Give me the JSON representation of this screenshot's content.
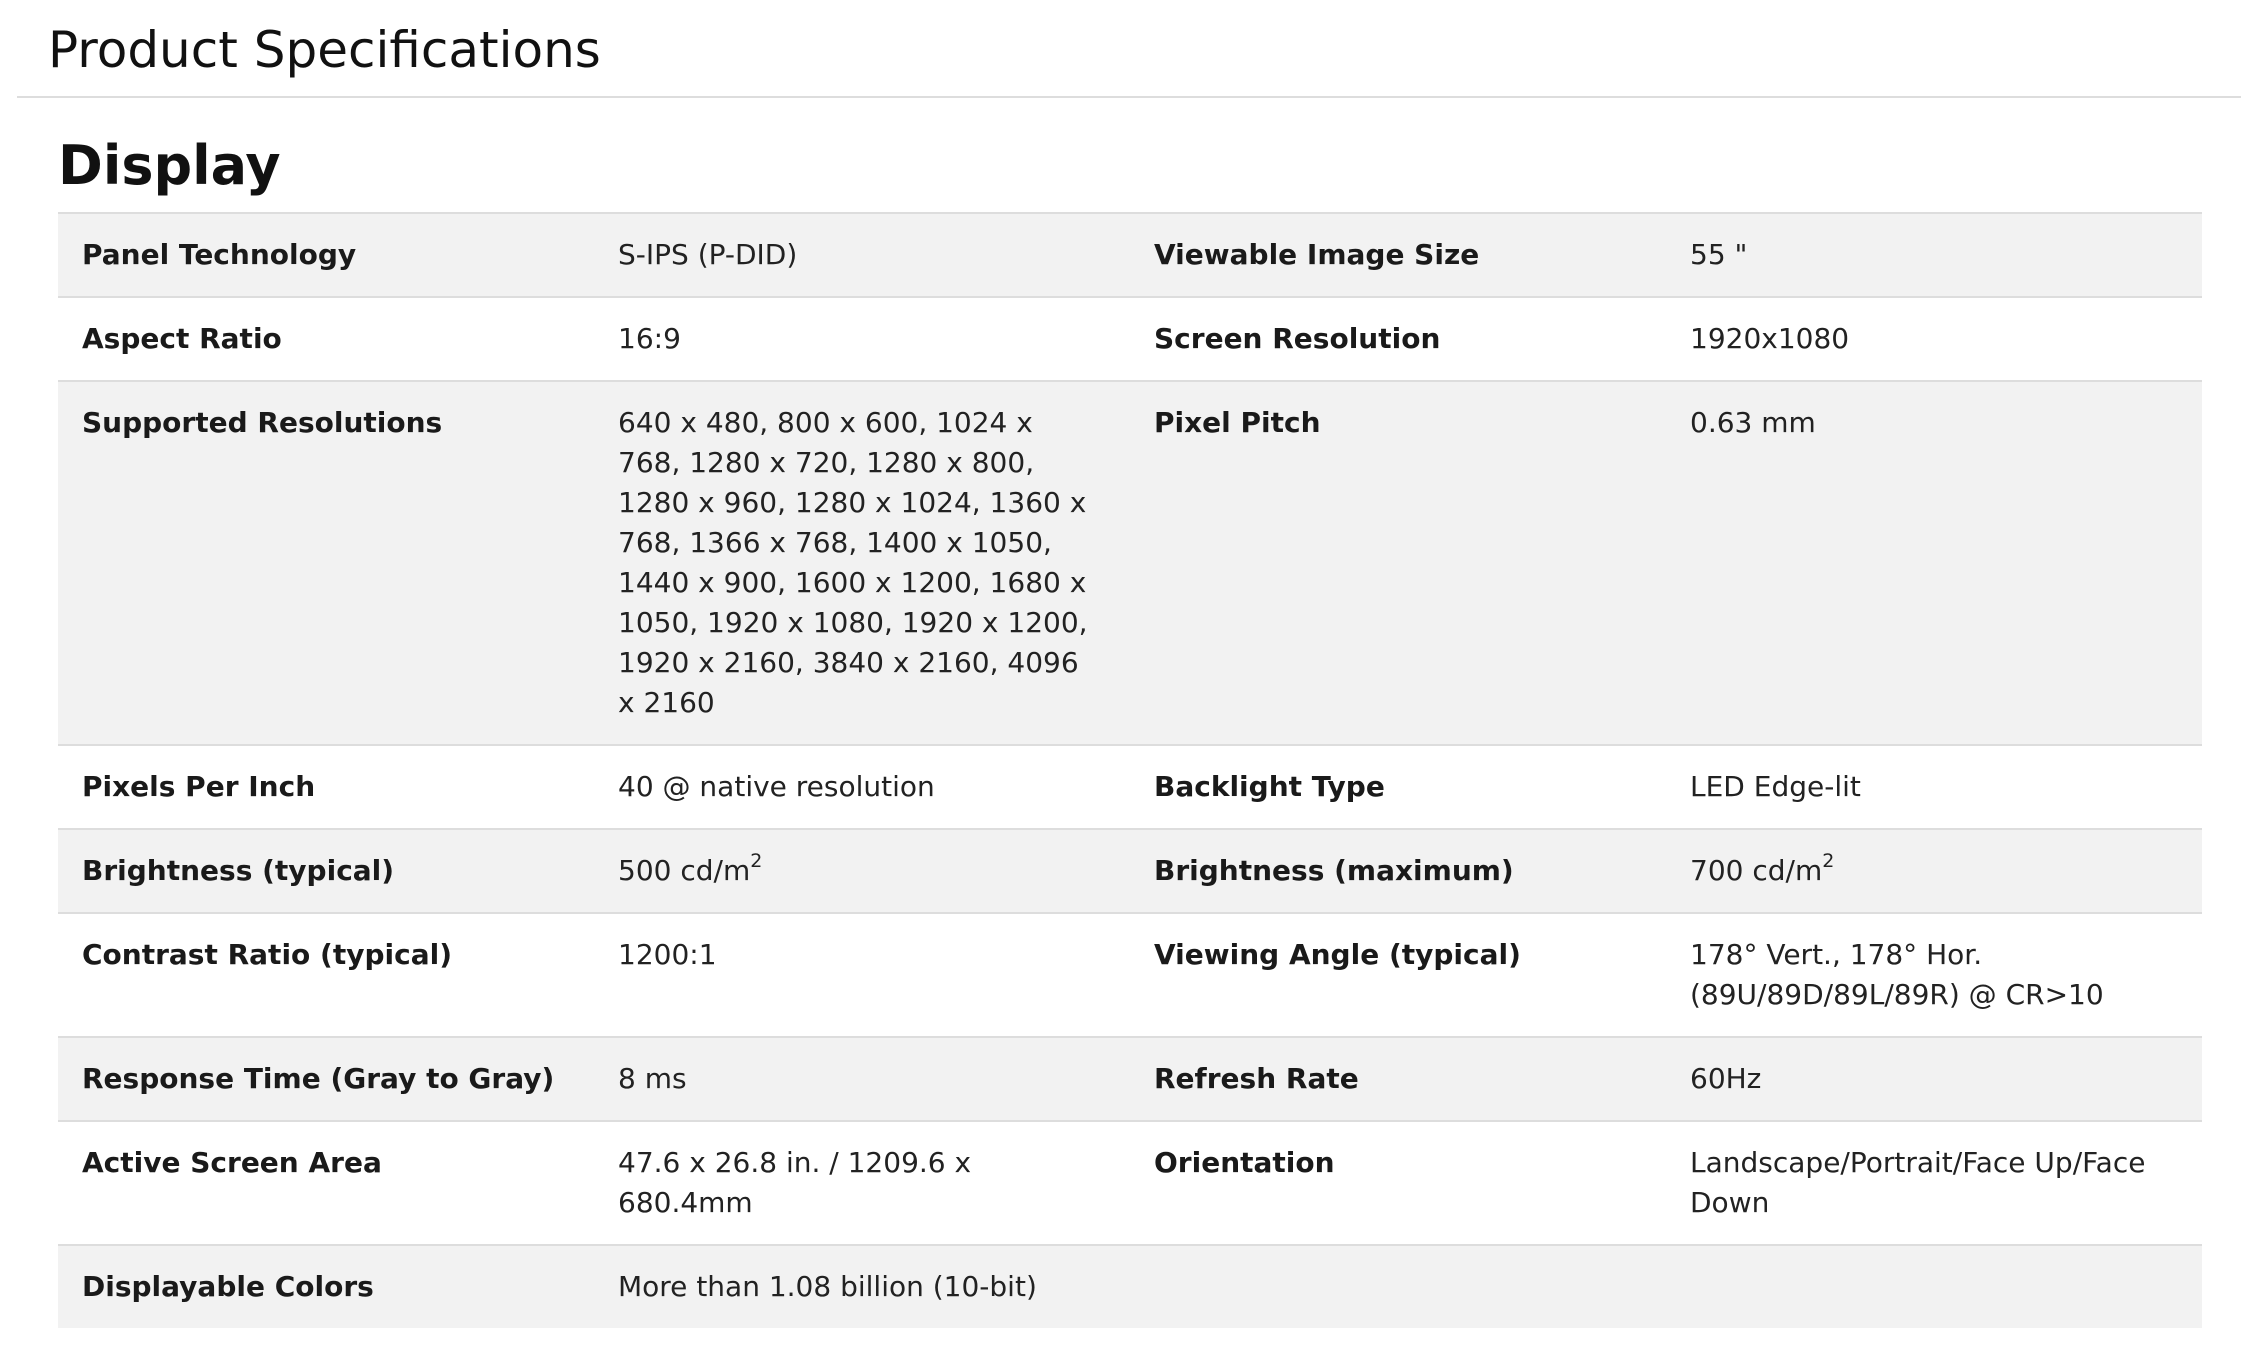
{
  "page": {
    "title": "Product Specifications"
  },
  "section": {
    "title": "Display"
  },
  "rows": [
    {
      "label1": "Panel Technology",
      "value1": "S-IPS (P-DID)",
      "label2": "Viewable Image Size",
      "value2": "55 \""
    },
    {
      "label1": "Aspect Ratio",
      "value1": "16:9",
      "label2": "Screen Resolution",
      "value2": "1920x1080"
    },
    {
      "label1": "Supported Resolutions",
      "value1": "640 x 480, 800 x 600, 1024 x 768, 1280 x 720, 1280 x 800, 1280 x 960, 1280 x 1024, 1360 x 768, 1366 x 768, 1400 x 1050, 1440 x 900, 1600 x 1200, 1680 x 1050, 1920 x 1080, 1920 x 1200, 1920 x 2160, 3840 x 2160, 4096 x 2160",
      "label2": "Pixel Pitch",
      "value2": "0.63 mm"
    },
    {
      "label1": "Pixels Per Inch",
      "value1": "40 @ native resolution",
      "label2": "Backlight Type",
      "value2": "LED Edge-lit"
    },
    {
      "label1": "Brightness (typical)",
      "value1": "500 cd/m",
      "value1_sup": "2",
      "label2": "Brightness (maximum)",
      "value2": "700 cd/m",
      "value2_sup": "2"
    },
    {
      "label1": "Contrast Ratio (typical)",
      "value1": "1200:1",
      "label2": "Viewing Angle (typical)",
      "value2": "178° Vert., 178° Hor. (89U/89D/89L/89R) @ CR>10"
    },
    {
      "label1": "Response Time (Gray to Gray)",
      "value1": "8 ms",
      "label2": "Refresh Rate",
      "value2": "60Hz"
    },
    {
      "label1": "Active Screen Area",
      "value1": "47.6 x 26.8 in. / 1209.6 x 680.4mm",
      "label2": "Orientation",
      "value2": "Landscape/Portrait/Face Up/Face Down"
    },
    {
      "label1": "Displayable Colors",
      "value1": "More than 1.08 billion (10-bit)",
      "label2": "",
      "value2": ""
    }
  ]
}
